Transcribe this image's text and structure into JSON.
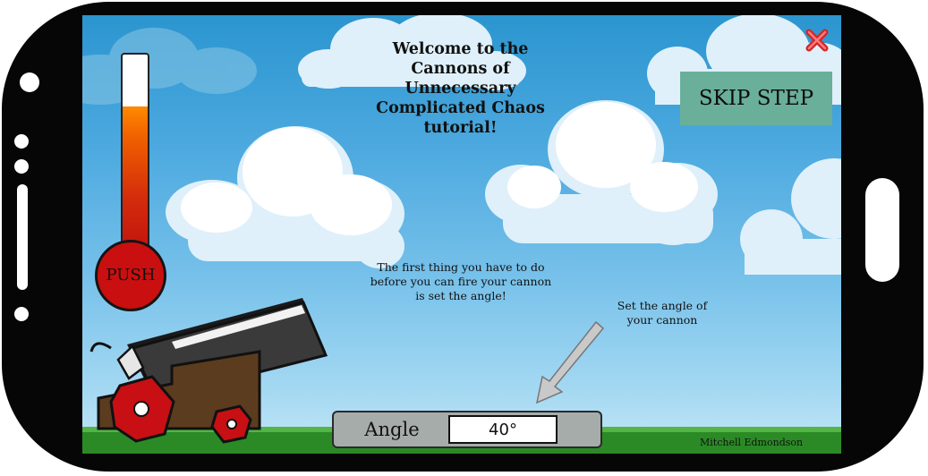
{
  "game": {
    "title": "Welcome to the Cannons of Unnecessary Complicated Chaos tutorial!",
    "skip_label": "SKIP STEP",
    "push_label": "PUSH",
    "power_level": 0.75,
    "instruction_text": "The first thing you have to do before you can fire your cannon is set the angle!",
    "hint_text": "Set the angle of your cannon",
    "angle_label": "Angle",
    "angle_value": "40°",
    "credit": "Mitchell Edmondson"
  },
  "icons": {
    "close": "close-x-icon",
    "arrow": "pointer-arrow-icon"
  },
  "colors": {
    "sky": "#4ca9df",
    "skip_button": "#6aaf9a",
    "push_button": "#c90f0f",
    "meter_fill": "#f06000",
    "grass": "#2b8a26",
    "close": "#e23a3a"
  }
}
